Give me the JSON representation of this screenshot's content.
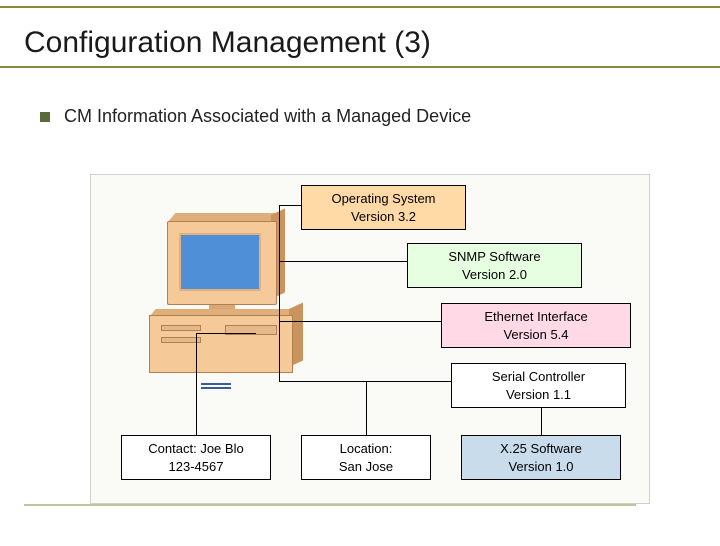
{
  "title": "Configuration Management (3)",
  "bullet": "CM Information Associated with a Managed Device",
  "boxes": {
    "os": {
      "line1": "Operating System",
      "line2": "Version 3.2"
    },
    "snmp": {
      "line1": "SNMP Software",
      "line2": "Version 2.0"
    },
    "eth": {
      "line1": "Ethernet Interface",
      "line2": "Version 5.4"
    },
    "serial": {
      "line1": "Serial Controller",
      "line2": "Version 1.1"
    },
    "contact": {
      "line1": "Contact: Joe Blo",
      "line2": "123-4567"
    },
    "location": {
      "line1": "Location:",
      "line2": "San Jose"
    },
    "x25": {
      "line1": "X.25 Software",
      "line2": "Version 1.0"
    }
  }
}
